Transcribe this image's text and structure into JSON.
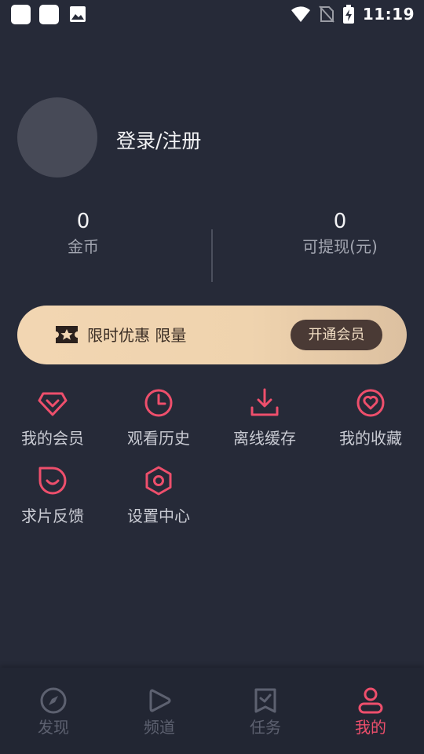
{
  "status_bar": {
    "time": "11:19"
  },
  "profile": {
    "login_label": "登录/注册"
  },
  "stats": [
    {
      "value": "0",
      "label": "金币"
    },
    {
      "value": "0",
      "label": "可提现(元)"
    }
  ],
  "vip_banner": {
    "text": "限时优惠 限量",
    "button_label": "开通会员"
  },
  "menu": [
    {
      "label": "我的会员",
      "icon": "diamond-icon"
    },
    {
      "label": "观看历史",
      "icon": "clock-icon"
    },
    {
      "label": "离线缓存",
      "icon": "download-icon"
    },
    {
      "label": "我的收藏",
      "icon": "heart-icon"
    },
    {
      "label": "求片反馈",
      "icon": "feedback-icon"
    },
    {
      "label": "设置中心",
      "icon": "settings-icon"
    }
  ],
  "tabs": [
    {
      "label": "发现",
      "icon": "compass-icon",
      "active": false
    },
    {
      "label": "频道",
      "icon": "play-icon",
      "active": false
    },
    {
      "label": "任务",
      "icon": "task-icon",
      "active": false
    },
    {
      "label": "我的",
      "icon": "user-icon",
      "active": true
    }
  ],
  "colors": {
    "accent": "#ee4f6c",
    "background": "#262a38",
    "vip_gold": "#f2d6b2"
  }
}
